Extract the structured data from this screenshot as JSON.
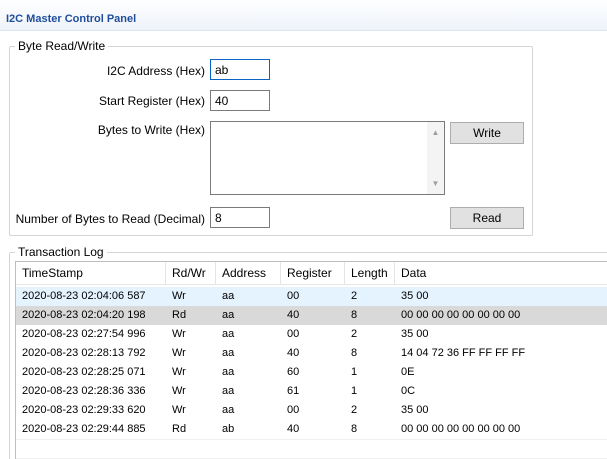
{
  "header": {
    "title": "I2C Master Control Panel"
  },
  "byte_rw": {
    "legend": "Byte Read/Write",
    "address_label": "I2C Address (Hex)",
    "address_value": "ab",
    "start_reg_label": "Start Register (Hex)",
    "start_reg_value": "40",
    "bytes_write_label": "Bytes to Write (Hex)",
    "bytes_write_value": "",
    "num_read_label": "Number of Bytes to Read (Decimal)",
    "num_read_value": "8",
    "write_button": "Write",
    "read_button": "Read"
  },
  "log": {
    "legend": "Transaction Log",
    "columns": [
      "TimeStamp",
      "Rd/Wr",
      "Address",
      "Register",
      "Length",
      "Data"
    ],
    "rows": [
      [
        "2020-08-23 02:04:06 587",
        "Wr",
        "aa",
        "00",
        "2",
        "35 00"
      ],
      [
        "2020-08-23 02:04:20 198",
        "Rd",
        "aa",
        "40",
        "8",
        "00 00 00 00 00 00 00 00"
      ],
      [
        "2020-08-23 02:27:54 996",
        "Wr",
        "aa",
        "00",
        "2",
        "35 00"
      ],
      [
        "2020-08-23 02:28:13 792",
        "Wr",
        "aa",
        "40",
        "8",
        "14 04 72 36 FF FF FF FF"
      ],
      [
        "2020-08-23 02:28:25 071",
        "Wr",
        "aa",
        "60",
        "1",
        "0E"
      ],
      [
        "2020-08-23 02:28:36 336",
        "Wr",
        "aa",
        "61",
        "1",
        "0C"
      ],
      [
        "2020-08-23 02:29:33 620",
        "Wr",
        "aa",
        "00",
        "2",
        "35 00"
      ],
      [
        "2020-08-23 02:29:44 885",
        "Rd",
        "ab",
        "40",
        "8",
        "00 00 00 00 00 00 00 00"
      ]
    ]
  }
}
